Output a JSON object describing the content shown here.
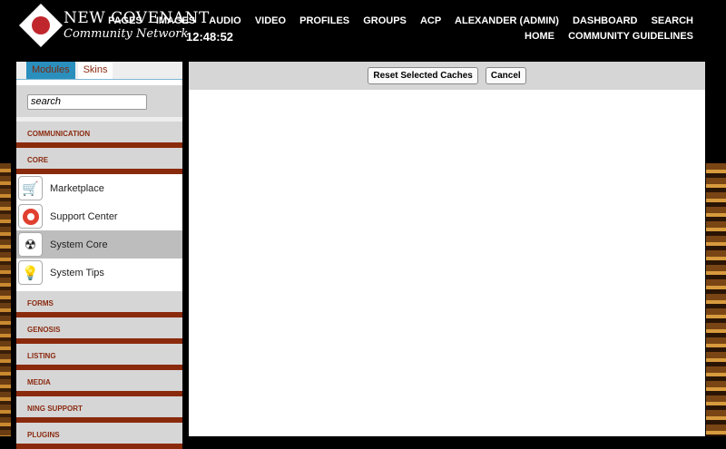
{
  "header": {
    "logo_line1": "New Covenant",
    "logo_line2": "Community Network",
    "clock": "12:48:52",
    "nav_row1": [
      "PAGES",
      "IMAGES",
      "AUDIO",
      "VIDEO",
      "PROFILES",
      "GROUPS",
      "ACP",
      "ALEXANDER (ADMIN)",
      "DASHBOARD",
      "SEARCH"
    ],
    "nav_row2": [
      "HOME",
      "COMMUNITY GUIDELINES"
    ]
  },
  "sidebar": {
    "tabs": [
      "Modules",
      "Skins"
    ],
    "search_value": "search",
    "categories_top": [
      "COMMUNICATION",
      "CORE"
    ],
    "items": [
      {
        "label": "Marketplace",
        "icon": "cart-icon"
      },
      {
        "label": "Support Center",
        "icon": "lifebuoy-icon"
      },
      {
        "label": "System Core",
        "icon": "radiation-icon"
      },
      {
        "label": "System Tips",
        "icon": "lightbulb-icon"
      }
    ],
    "categories_bottom": [
      "FORMS",
      "GENOSIS",
      "LISTING",
      "MEDIA",
      "NING SUPPORT",
      "PLUGINS"
    ]
  },
  "toolbar": {
    "reset_label": "Reset Selected Caches",
    "cancel_label": "Cancel"
  }
}
